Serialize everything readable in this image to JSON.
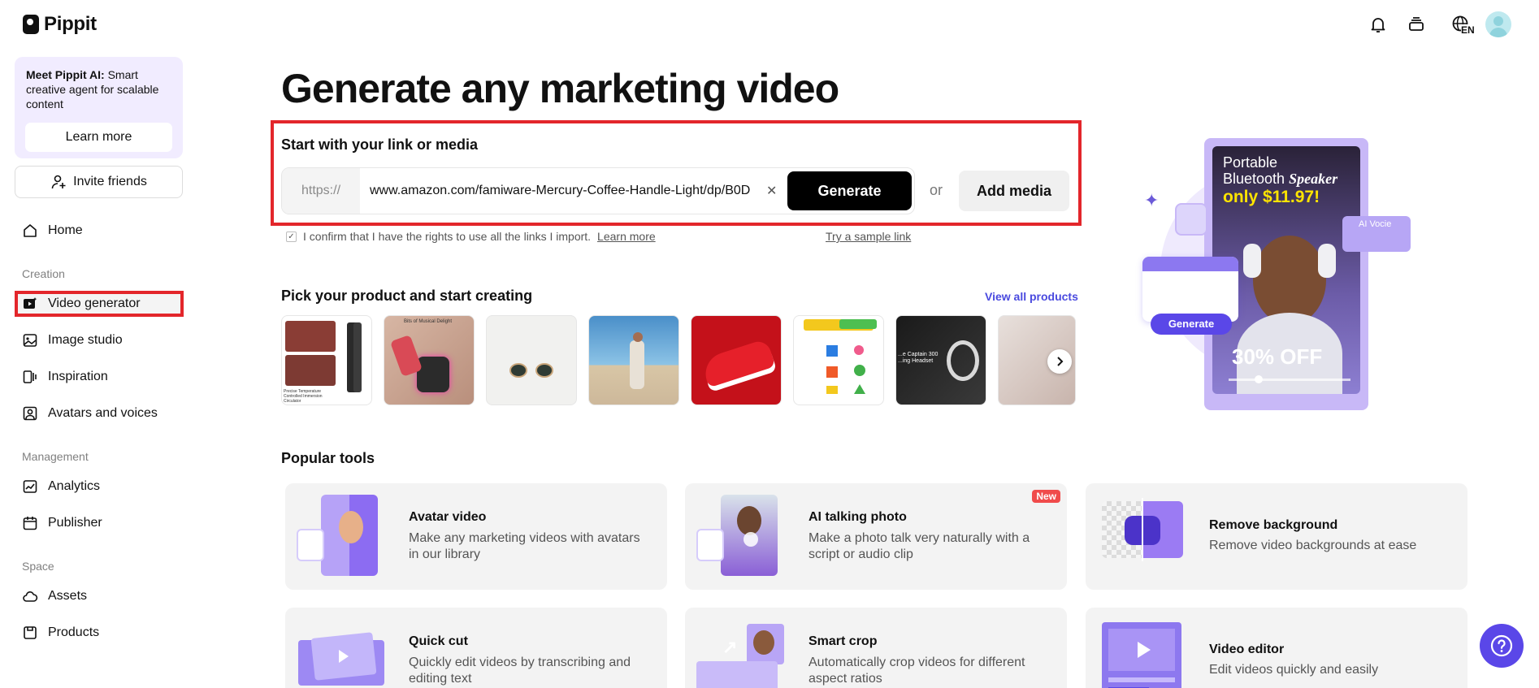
{
  "app": {
    "name": "Pippit"
  },
  "sidebar": {
    "promo": {
      "bold": "Meet Pippit AI:",
      "text": " Smart creative agent for scalable content",
      "button": "Learn more"
    },
    "invite": "Invite friends",
    "home": "Home",
    "sections": {
      "creation": "Creation",
      "management": "Management",
      "space": "Space"
    },
    "items": {
      "video_generator": "Video generator",
      "image_studio": "Image studio",
      "inspiration": "Inspiration",
      "avatars": "Avatars and voices",
      "analytics": "Analytics",
      "publisher": "Publisher",
      "assets": "Assets",
      "products": "Products"
    },
    "active_item": "Video generator"
  },
  "header": {
    "language": "EN"
  },
  "main": {
    "title": "Generate any marketing video",
    "link": {
      "heading": "Start with your link or media",
      "prefix": "https://",
      "value": "www.amazon.com/famiware-Mercury-Coffee-Handle-Light/dp/B0D",
      "generate": "Generate",
      "or": "or",
      "add_media": "Add media",
      "confirm": "I confirm that I have the rights to use all the links I import.",
      "confirm_link": "Learn more",
      "sample": "Try a sample link"
    },
    "products": {
      "heading": "Pick your product and start creating",
      "view_all": "View all products",
      "thumb_texts": {
        "t1_caption": "Precise Temperature Controlled Immersion Circulator",
        "t2_caption": "Bits of Musical Delight",
        "t7_caption": "...e Captain 300 ...ing Headset"
      }
    },
    "hero": {
      "line1": "Portable",
      "line2": "Bluetooth",
      "line2b": "Speaker",
      "price": "only $11.97!",
      "badge": "AI Vocie",
      "button": "Generate",
      "discount": "30% OFF"
    },
    "popular": {
      "heading": "Popular tools",
      "tools": [
        {
          "title": "Avatar video",
          "desc": "Make any marketing videos with avatars in our library"
        },
        {
          "title": "AI talking photo",
          "desc": "Make a photo talk very naturally with a script or audio clip",
          "badge": "New"
        },
        {
          "title": "Remove background",
          "desc": "Remove video backgrounds at ease"
        },
        {
          "title": "Quick cut",
          "desc": "Quickly edit videos by transcribing and editing text"
        },
        {
          "title": "Smart crop",
          "desc": "Automatically crop videos for different aspect ratios"
        },
        {
          "title": "Video editor",
          "desc": "Edit videos quickly and easily"
        }
      ]
    }
  },
  "colors": {
    "accent": "#5a47e8",
    "highlight": "#e3262b",
    "promo_bg": "#f1ecff"
  }
}
